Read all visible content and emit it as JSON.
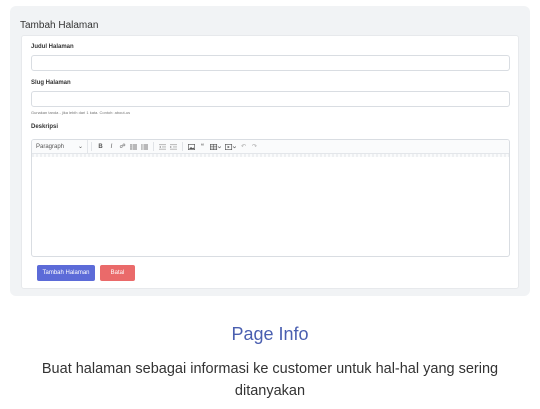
{
  "form": {
    "title": "Tambah Halaman",
    "fields": {
      "judul": {
        "label": "Judul Halaman",
        "value": "",
        "placeholder": ""
      },
      "slug": {
        "label": "Slug Halaman",
        "value": "",
        "placeholder": "",
        "hint": "Gunakan tanda - jika lebih dari 1 kata. Contoh: about-us"
      },
      "deskripsi": {
        "label": "Deskripsi"
      }
    },
    "editor": {
      "paragraph_select": "Paragraph",
      "icons": [
        "bold-icon",
        "italic-icon",
        "link-icon",
        "bulleted-list-icon",
        "numbered-list-icon",
        "outdent-icon",
        "indent-icon",
        "image-icon",
        "blockquote-icon",
        "table-icon",
        "media-icon",
        "undo-icon",
        "redo-icon"
      ]
    },
    "buttons": {
      "submit": "Tambah Halaman",
      "cancel": "Batal"
    }
  },
  "info": {
    "title": "Page Info",
    "description": "Buat halaman sebagai informasi ke customer untuk hal-hal yang sering ditanyakan"
  },
  "colors": {
    "primary": "#5c6bd8",
    "danger": "#ea6a6a",
    "info_title": "#4a5fb0"
  }
}
